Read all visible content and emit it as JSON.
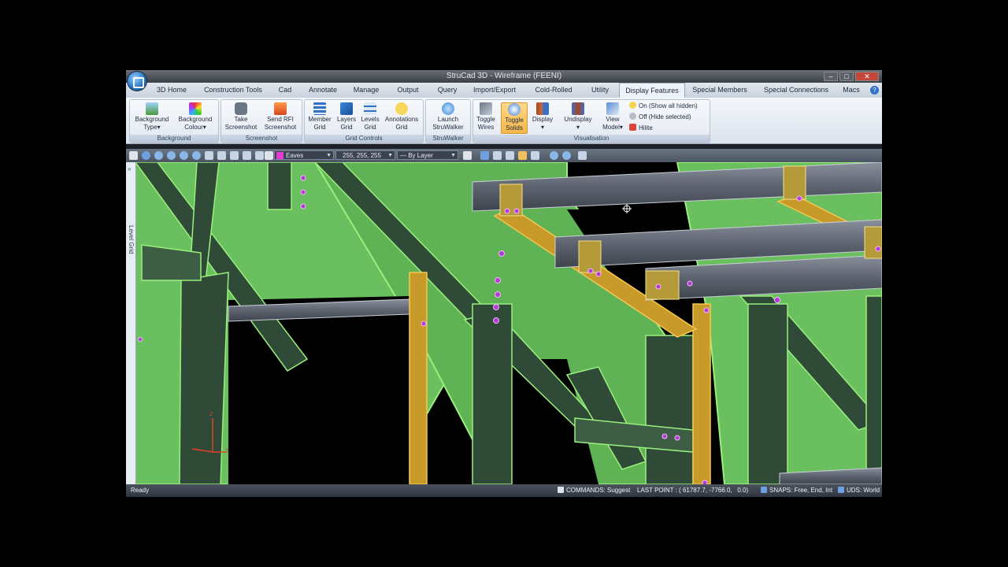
{
  "window": {
    "title": "StruCad 3D - Wireframe (FEENI)",
    "buttons": [
      "–",
      "□",
      "✕"
    ]
  },
  "tabs": [
    {
      "label": "3D Home"
    },
    {
      "label": "Construction Tools"
    },
    {
      "label": "Cad"
    },
    {
      "label": "Annotate"
    },
    {
      "label": "Manage"
    },
    {
      "label": "Output"
    },
    {
      "label": "Query"
    },
    {
      "label": "Import/Export"
    },
    {
      "label": "Cold-Rolled"
    },
    {
      "label": "Utility"
    },
    {
      "label": "Display Features",
      "active": true
    },
    {
      "label": "Special Members"
    },
    {
      "label": "Special Connections"
    },
    {
      "label": "Macs"
    }
  ],
  "ribbon": {
    "background": {
      "label": "Background",
      "buttons": [
        {
          "line1": "Background",
          "line2": "Type▾",
          "icon": "picture-icon"
        },
        {
          "line1": "Background",
          "line2": "Colour▾",
          "icon": "colour-picker-icon"
        }
      ]
    },
    "screenshot": {
      "label": "Screenshot",
      "buttons": [
        {
          "line1": "Take",
          "line2": "Screenshot",
          "icon": "camera-icon"
        },
        {
          "line1": "Send RFI",
          "line2": "Screenshot",
          "icon": "rfi-icon"
        }
      ]
    },
    "grid_controls": {
      "label": "Grid Controls",
      "buttons": [
        {
          "line1": "Member",
          "line2": "Grid",
          "icon": "member-grid-icon"
        },
        {
          "line1": "Layers",
          "line2": "Grid",
          "icon": "layers-grid-icon"
        },
        {
          "line1": "Levels",
          "line2": "Grid",
          "icon": "levels-grid-icon"
        },
        {
          "line1": "Annotations",
          "line2": "Grid",
          "icon": "annotations-grid-icon"
        }
      ]
    },
    "struwalker": {
      "label": "StruWalker",
      "buttons": [
        {
          "line1": "Launch",
          "line2": "StruWalker",
          "icon": "walker-icon"
        }
      ]
    },
    "visualisation": {
      "label": "Visualisation",
      "buttons": [
        {
          "line1": "Toggle",
          "line2": "Wires",
          "icon": "wires-icon"
        },
        {
          "line1": "Toggle",
          "line2": "Solids",
          "icon": "solids-icon",
          "active": true
        },
        {
          "line1": "Display",
          "line2": "▾",
          "icon": "display-icon"
        },
        {
          "line1": "Undisplay",
          "line2": "▾",
          "icon": "undisplay-icon"
        },
        {
          "line1": "View",
          "line2": "Model▾",
          "icon": "view-model-icon"
        }
      ],
      "small_items": [
        {
          "label": "On (Show all hidden)",
          "icon": "bulb-on-icon"
        },
        {
          "label": "Off (Hide selected)",
          "icon": "bulb-off-icon"
        },
        {
          "label": "Hilite",
          "icon": "hilite-icon"
        }
      ]
    }
  },
  "toolbar": {
    "layer_name": "Eaves",
    "layer_colour": "#e837d6",
    "rgb_value": "255, 255, 255",
    "linetype": "— By Layer"
  },
  "side_panel": {
    "label": "Level Grid"
  },
  "statusbar": {
    "ready": "Ready",
    "commands": "COMMANDS: Suggest",
    "last_point_label": "LAST POINT : (",
    "last_point_x": "61787.7,",
    "last_point_y": "-7766.0,",
    "last_point_z": "0.0)",
    "snaps": "SNAPS: Free, End, Int",
    "ucs": "UDS: World"
  },
  "colors": {
    "steel_green": "#6abf5e",
    "steel_dark": "#2f4a36",
    "edge_highlight": "#9af07c",
    "purlin_grey": "#6f7683",
    "bracing_orange": "#c89a2a",
    "bolt_magenta": "#b23bd0",
    "ribbon_bg": "#e3e9f1",
    "active_button": "#f5b74a"
  }
}
